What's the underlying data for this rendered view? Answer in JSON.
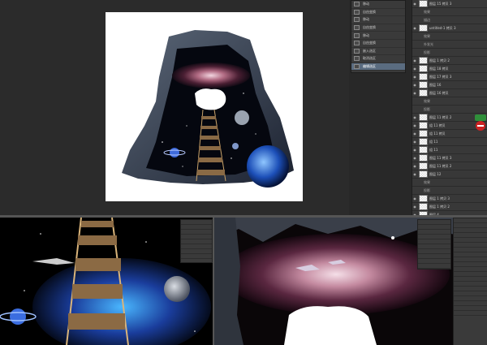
{
  "history_panel": {
    "items": [
      "移动",
      "自由变换",
      "移动",
      "自由变换",
      "移动",
      "自由变换",
      "嵌入选区",
      "取消选区",
      "编辑选区"
    ]
  },
  "layers_panel": {
    "layers": [
      {
        "label": "图层 15 拷贝 3",
        "kind": "normal"
      },
      {
        "label": "效果",
        "kind": "sub"
      },
      {
        "label": "描边",
        "kind": "sub"
      },
      {
        "label": "untitled-1 拷贝 3",
        "kind": "normal"
      },
      {
        "label": "效果",
        "kind": "sub"
      },
      {
        "label": "外发光",
        "kind": "sub"
      },
      {
        "label": "投影",
        "kind": "sub"
      },
      {
        "label": "图层 1 拷贝 2",
        "kind": "normal"
      },
      {
        "label": "图层 18 拷贝",
        "kind": "normal"
      },
      {
        "label": "图层 17 拷贝 3",
        "kind": "normal"
      },
      {
        "label": "图层 16",
        "kind": "normal"
      },
      {
        "label": "图层 16 拷贝",
        "kind": "normal"
      },
      {
        "label": "效果",
        "kind": "sub"
      },
      {
        "label": "投影",
        "kind": "sub"
      },
      {
        "label": "图层 11 拷贝 2",
        "kind": "normal"
      },
      {
        "label": "组 11 拷贝",
        "kind": "normal"
      },
      {
        "label": "组 11 拷贝",
        "kind": "normal"
      },
      {
        "label": "组 11",
        "kind": "normal"
      },
      {
        "label": "组 11",
        "kind": "normal"
      },
      {
        "label": "图层 11 拷贝 3",
        "kind": "normal"
      },
      {
        "label": "图层 11 拷贝 2",
        "kind": "normal"
      },
      {
        "label": "图层 12",
        "kind": "normal"
      },
      {
        "label": "效果",
        "kind": "sub"
      },
      {
        "label": "投影",
        "kind": "sub"
      },
      {
        "label": "图层 1 拷贝 3",
        "kind": "normal"
      },
      {
        "label": "图层 1 拷贝 2",
        "kind": "normal"
      },
      {
        "label": "图层 4",
        "kind": "normal"
      }
    ]
  },
  "colors": {
    "panel_bg": "#383838",
    "canvas_bg": "#2b2b2b",
    "selection": "#5a6c80",
    "badge_green": "#2f8f3a",
    "badge_red": "#cc2222"
  }
}
